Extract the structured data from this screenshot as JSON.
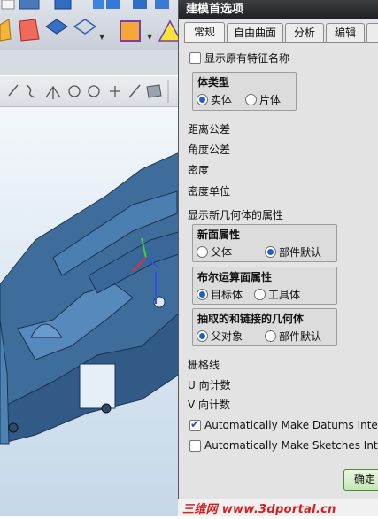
{
  "dialog": {
    "title": "建模首选项",
    "tabs": [
      "常规",
      "自由曲面",
      "分析",
      "编辑"
    ],
    "show_original_feature_name": "显示原有特征名称",
    "body_type": {
      "title": "体类型",
      "options": [
        "实体",
        "片体"
      ],
      "selected": "实体"
    },
    "distance_tolerance": "距离公差",
    "angle_tolerance": "角度公差",
    "density": "密度",
    "density_unit": "密度单位",
    "new_geometry_props": "显示新几何体的属性",
    "new_face_props": {
      "title": "新面属性",
      "options": [
        "父体",
        "部件默认"
      ],
      "selected": "部件默认"
    },
    "boolean_face_props": {
      "title": "布尔运算面属性",
      "options": [
        "目标体",
        "工具体"
      ],
      "selected": "目标体"
    },
    "extracted_linked_geometry": {
      "title": "抽取的和链接的几何体",
      "options": [
        "父对象",
        "部件默认"
      ],
      "selected": "父对象"
    },
    "grid_lines": "栅格线",
    "u_count": "U 向计数",
    "v_count": "V 向计数",
    "auto_datums": {
      "label": "Automatically Make Datums Inter",
      "checked": true
    },
    "auto_sketches": {
      "label": "Automatically Make Sketches Inte",
      "checked": false
    },
    "ok_button": "确定"
  },
  "watermark": "三维网 www.3dportal.cn",
  "colors": {
    "title_bar": "#1f2023",
    "dialog_bg": "#e3e3e3",
    "model_blue": "#3e6d9c",
    "watermark": "#d81f1f"
  }
}
